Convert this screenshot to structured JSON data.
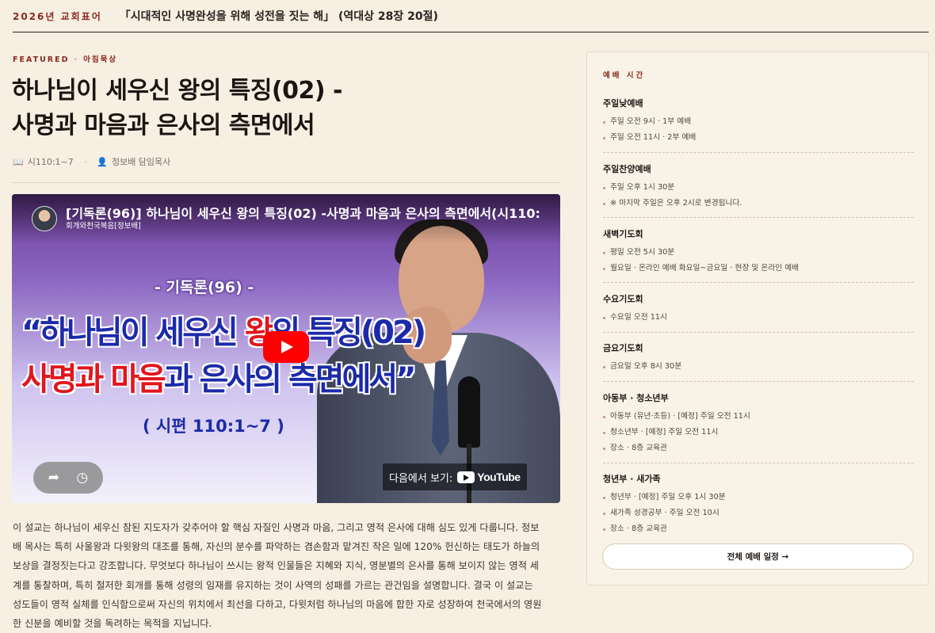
{
  "topbar": {
    "year_label": "2026년 교회표어",
    "verse": "「시대적인 사명완성을 위해 성전을 짓는 해」 (역대상 28장 20절)"
  },
  "featured": {
    "label": "FEATURED",
    "category": "아침묵상"
  },
  "article": {
    "title_lines": [
      "하나님이 세우신 왕의 특징(02) -",
      "사명과 마음과 은사의 측면에서"
    ],
    "scripture": "시110:1~7",
    "author": "정보배 담임목사",
    "icons": {
      "scripture": "book-icon",
      "author": "person-icon"
    }
  },
  "video": {
    "title": "[기독론(96)] 하나님이 세우신 왕의 특징(02) -사명과 마음과 은사의 측면에서(시110:",
    "channel": "회개와천국복음[정보배]",
    "thumb_subtitle": "- 기독론(96) -",
    "thumb_line1_pre": "“하나님이 세우신 ",
    "thumb_line1_red": "왕",
    "thumb_line1_post": "의 특징(02)",
    "thumb_line2_red": "사명과 마음",
    "thumb_line2_post": "과 은사의 측면에서”",
    "thumb_reference": "( 시편 110:1~7 )",
    "watch_on_label": "다음에서 보기:",
    "brand": "YouTube",
    "icons": {
      "play": "play-icon",
      "share": "share-icon",
      "watch_later": "clock-icon"
    }
  },
  "summary_lines": [
    "이 설교는 하나님이 세우신 참된 지도자가 갖추어야 할 핵심 자질인 사명과 마음, 그리고 영적 은사에 대해 심도 있게 다룹니다. 정보",
    "배 목사는 특히 사울왕과 다윗왕의 대조를 통해, 자신의 분수를 파악하는 겸손함과 맡겨진 작은 일에 120% 헌신하는 태도가 하늘의",
    "보상을 결정짓는다고 강조합니다. 무엇보다 하나님이 쓰시는 왕적 인물들은 지혜와 지식, 영분별의 은사를 통해 보이지 않는 영적 세",
    "계를 통찰하며, 특히 철저한 회개를 통해 성령의 임재를 유지하는 것이 사역의 성패를 가르는 관건임을 설명합니다. 결국 이 설교는",
    "성도들이 영적 실체를 인식함으로써 자신의 위치에서 최선을 다하고, 다윗처럼 하나님의 마음에 합한 자로 성장하여 천국에서의 영원",
    "한 신분을 예비할 것을 독려하는 목적을 지닙니다."
  ],
  "sidebar": {
    "heading": "예배 시간",
    "services": [
      {
        "name": "주일낮예배",
        "lines": [
          "주일 오전 9시 · 1부 예배",
          "주일 오전 11시 · 2부 예배"
        ]
      },
      {
        "name": "주일찬양예배",
        "lines": [
          "주일 오후 1시 30분",
          "※ 마지막 주일은 오후 2시로 변경됩니다."
        ]
      },
      {
        "name": "새벽기도회",
        "lines": [
          "평일 오전 5시 30분",
          "월요일 · 온라인 예배 화요일~금요일 · 현장 및 온라인 예배"
        ]
      },
      {
        "name": "수요기도회",
        "lines": [
          "수요일 오전 11시"
        ]
      },
      {
        "name": "금요기도회",
        "lines": [
          "금요일 오후 8시 30분"
        ]
      },
      {
        "name": "아동부 · 청소년부",
        "lines": [
          "아동부 (유년·초등) · [예정] 주일 오전 11시",
          "청소년부 · [예정] 주일 오전 11시",
          "장소 · 8층 교육관"
        ]
      },
      {
        "name": "청년부 · 새가족",
        "lines": [
          "청년부 · [예정] 주일 오후 1시 30분",
          "새가족 성경공부 · 주일 오전 10시",
          "장소 · 8층 교육관"
        ]
      }
    ],
    "schedule_button": "전체 예배 일정 →"
  },
  "colors": {
    "background": "#f6efe2",
    "accent": "#8a2a1f",
    "youtube_red": "#ff0000"
  }
}
